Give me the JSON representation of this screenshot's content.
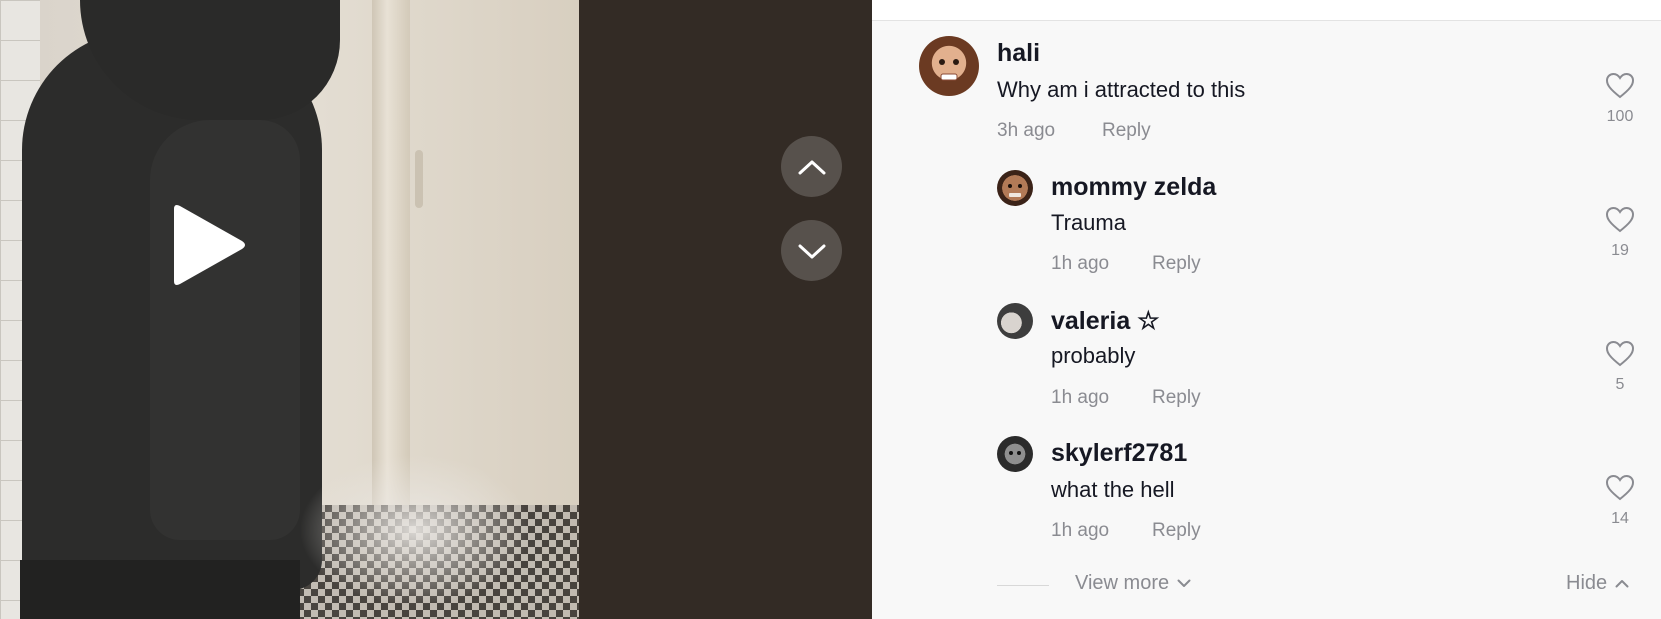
{
  "video": {
    "play_icon": "play-icon",
    "nav_up_icon": "chevron-up-icon",
    "nav_down_icon": "chevron-down-icon"
  },
  "comments": [
    {
      "username": "hali",
      "text": "Why am i attracted to this",
      "time": "3h ago",
      "reply_label": "Reply",
      "likes": "100"
    },
    {
      "username": "mommy zelda",
      "text": "Trauma",
      "time": "1h ago",
      "reply_label": "Reply",
      "likes": "19"
    },
    {
      "username": "valeria ☆",
      "text": "probably",
      "time": "1h ago",
      "reply_label": "Reply",
      "likes": "5"
    },
    {
      "username": "skylerf2781",
      "text": "what the hell",
      "time": "1h ago",
      "reply_label": "Reply",
      "likes": "14"
    }
  ],
  "footer": {
    "view_more_label": "View more",
    "hide_label": "Hide"
  },
  "colors": {
    "text_primary": "#161823",
    "text_secondary": "#8a8b91",
    "video_bg": "#332b25"
  }
}
